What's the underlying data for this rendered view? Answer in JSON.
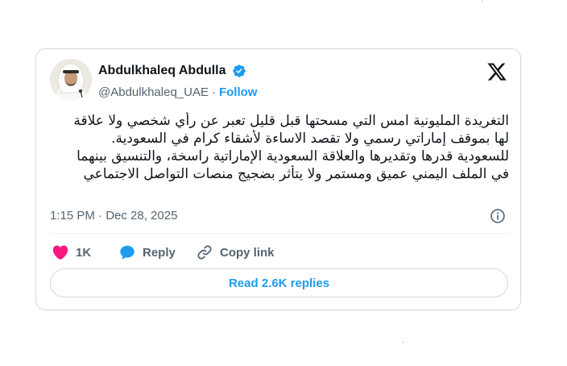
{
  "author": {
    "name": "Abdulkhaleq Abdulla",
    "handle": "@Abdulkhaleq_UAE",
    "separator": "·",
    "follow_label": "Follow"
  },
  "tweet": {
    "lines": [
      "التغريدة المليونية امس التي مسحتها قبل قليل تعبر عن رأي شخصي ولا علاقة",
      "لها بموقف إماراتي رسمي ولا تقصد الاساءة لأشقاء كرام في السعودية.",
      "للسعودية قدرها وتقديرها والعلاقة السعودية الإماراتية راسخة، والتنسيق بينهما",
      "في الملف اليمني عميق ومستمر ولا يتأثر بضجيج منصات التواصل الاجتماعي"
    ],
    "timestamp": "1:15 PM · Dec 28, 2025"
  },
  "actions": {
    "like_count": "1K",
    "reply_label": "Reply",
    "copy_link_label": "Copy link"
  },
  "replies_button": "Read 2.6K replies",
  "stray_marks": [
    "·",
    "·"
  ],
  "icons": {
    "verified": "verified-badge-icon",
    "x_logo": "x-logo-icon",
    "info": "info-icon",
    "like": "heart-icon",
    "reply": "speech-bubble-icon",
    "copy": "link-icon"
  },
  "colors": {
    "accent": "#1d9bf0",
    "heart": "#f91880",
    "secondary_text": "#536471",
    "border": "#cfd9de"
  }
}
